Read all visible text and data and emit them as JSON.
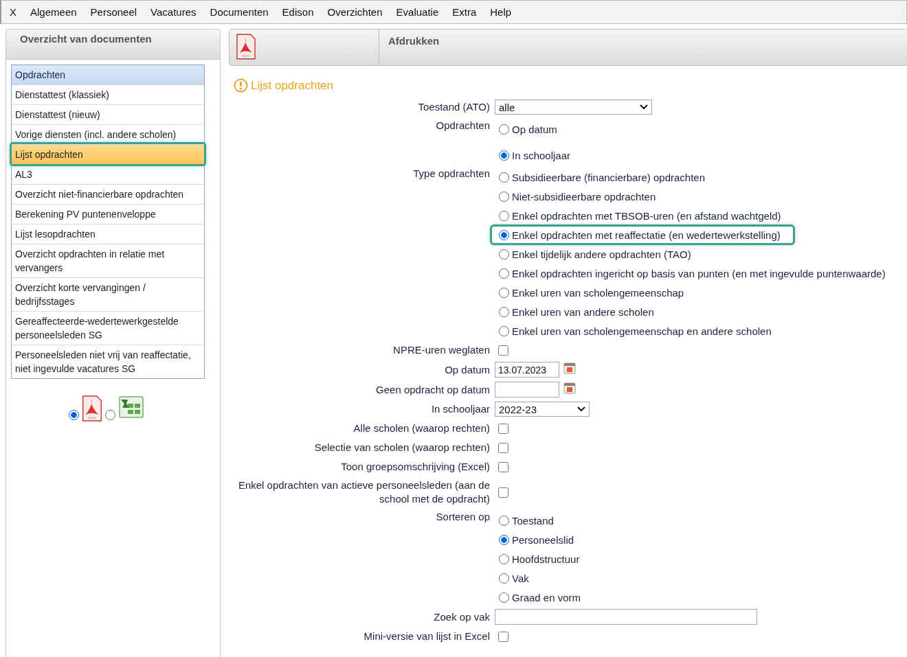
{
  "menu": [
    "X",
    "Algemeen",
    "Personeel",
    "Vacatures",
    "Documenten",
    "Edison",
    "Overzichten",
    "Evaluatie",
    "Extra",
    "Help"
  ],
  "sidebar": {
    "title": "Overzicht van documenten",
    "items": [
      {
        "label": "Opdrachten",
        "kind": "header",
        "selected": false,
        "highlighted": false
      },
      {
        "label": "Dienstattest (klassiek)",
        "kind": "item",
        "selected": false,
        "highlighted": false
      },
      {
        "label": "Dienstattest (nieuw)",
        "kind": "item",
        "selected": false,
        "highlighted": false
      },
      {
        "label": "Vorige diensten (incl. andere scholen)",
        "kind": "item",
        "selected": false,
        "highlighted": false
      },
      {
        "label": "Lijst opdrachten",
        "kind": "item",
        "selected": true,
        "highlighted": true
      },
      {
        "label": "AL3",
        "kind": "item",
        "selected": false,
        "highlighted": false
      },
      {
        "label": "Overzicht niet-financierbare opdrachten",
        "kind": "item",
        "selected": false,
        "highlighted": false
      },
      {
        "label": "Berekening PV puntenenveloppe",
        "kind": "item",
        "selected": false,
        "highlighted": false
      },
      {
        "label": "Lijst lesopdrachten",
        "kind": "item",
        "selected": false,
        "highlighted": false
      },
      {
        "label": "Overzicht opdrachten in relatie met vervangers",
        "kind": "item",
        "selected": false,
        "highlighted": false
      },
      {
        "label": "Overzicht korte vervangingen / bedrijfsstages",
        "kind": "item",
        "selected": false,
        "highlighted": false
      },
      {
        "label": "Gereaffecteerde-wedertewerkgestelde personeelsleden SG",
        "kind": "item",
        "selected": false,
        "highlighted": false
      },
      {
        "label": "Personeelsleden niet vrij van reaffectatie, niet ingevulde vacatures SG",
        "kind": "item",
        "selected": false,
        "highlighted": false
      }
    ],
    "formats": [
      {
        "kind": "pdf",
        "selected": true
      },
      {
        "kind": "excel",
        "selected": false
      }
    ]
  },
  "panel": {
    "title": "Afdrukken",
    "heading": "Lijst opdrachten"
  },
  "form": [
    {
      "kind": "select",
      "label": "Toestand (ATO)",
      "value": "alle",
      "wide": true
    },
    {
      "kind": "radio",
      "label": "Opdrachten",
      "options": [
        {
          "label": "Op datum",
          "selected": false,
          "highlighted": false
        },
        {
          "label": "In schooljaar",
          "selected": true,
          "highlighted": false
        }
      ]
    },
    {
      "kind": "radio",
      "label": "Type opdrachten",
      "options": [
        {
          "label": "Subsidieerbare (financierbare) opdrachten",
          "selected": false,
          "highlighted": false
        },
        {
          "label": "Niet-subsidieerbare opdrachten",
          "selected": false,
          "highlighted": false
        },
        {
          "label": "Enkel opdrachten met TBSOB-uren (en afstand wachtgeld)",
          "selected": false,
          "highlighted": false
        },
        {
          "label": "Enkel opdrachten met reaffectatie (en wedertewerkstelling)",
          "selected": true,
          "highlighted": true
        },
        {
          "label": "Enkel tijdelijk andere opdrachten (TAO)",
          "selected": false,
          "highlighted": false
        },
        {
          "label": "Enkel opdrachten ingericht op basis van punten (en met ingevulde puntenwaarde)",
          "selected": false,
          "highlighted": false
        },
        {
          "label": "Enkel uren van scholengemeenschap",
          "selected": false,
          "highlighted": false
        },
        {
          "label": "Enkel uren van andere scholen",
          "selected": false,
          "highlighted": false
        },
        {
          "label": "Enkel uren van scholengemeenschap en andere scholen",
          "selected": false,
          "highlighted": false
        }
      ]
    },
    {
      "kind": "checkbox",
      "label": "NPRE-uren weglaten",
      "checked": false
    },
    {
      "kind": "date",
      "label": "Op datum",
      "value": "13.07.2023"
    },
    {
      "kind": "date",
      "label": "Geen opdracht op datum"
    },
    {
      "kind": "select",
      "label": "In schooljaar",
      "value": "2022-23",
      "wide": false
    },
    {
      "kind": "checkbox",
      "label": "Alle scholen (waarop rechten)",
      "checked": false
    },
    {
      "kind": "checkbox",
      "label": "Selectie van scholen (waarop rechten)",
      "checked": false
    },
    {
      "kind": "checkbox",
      "label": "Toon groepsomschrijving (Excel)",
      "checked": false
    },
    {
      "kind": "checkbox",
      "label": "Enkel opdrachten van actieve personeelsleden    (aan de school met de opdracht)",
      "checked": false
    },
    {
      "kind": "radio",
      "label": "Sorteren op",
      "options": [
        {
          "label": "Toestand",
          "selected": false,
          "highlighted": false
        },
        {
          "label": "Personeelslid",
          "selected": true,
          "highlighted": false
        },
        {
          "label": "Hoofdstructuur",
          "selected": false,
          "highlighted": false
        },
        {
          "label": "Vak",
          "selected": false,
          "highlighted": false
        },
        {
          "label": "Graad en vorm",
          "selected": false,
          "highlighted": false
        }
      ]
    },
    {
      "kind": "text",
      "label": "Zoek op vak"
    },
    {
      "kind": "checkbox",
      "label": "Mini-versie van lijst in Excel",
      "checked": false
    }
  ]
}
